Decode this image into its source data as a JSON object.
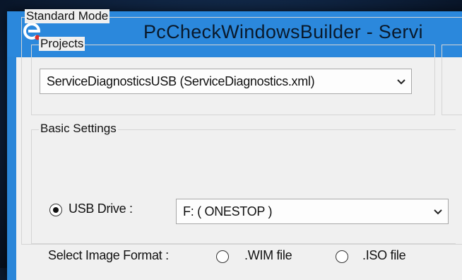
{
  "window": {
    "title": "PcCheckWindowsBuilder  - Servi",
    "icon": "app-e-icon",
    "titlebar_color": "#2b88dc"
  },
  "standard_mode": {
    "label": "Standard Mode"
  },
  "projects": {
    "label": "Projects",
    "selected": "ServiceDiagnosticsUSB (ServiceDiagnostics.xml)"
  },
  "basic_settings": {
    "label": "Basic Settings",
    "usb_drive": {
      "label": "USB Drive :",
      "checked": true,
      "selected": "F: ( ONESTOP )"
    },
    "image_format": {
      "label": "Select Image Format :",
      "options": [
        {
          "label": ".WIM file",
          "checked": false
        },
        {
          "label": ".ISO file",
          "checked": false
        }
      ]
    }
  }
}
